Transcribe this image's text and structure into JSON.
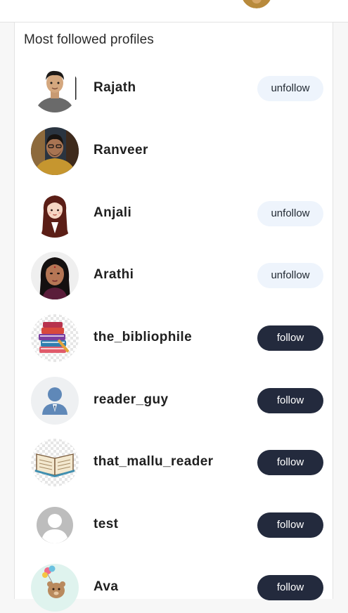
{
  "section": {
    "title": "Most followed profiles"
  },
  "profiles": [
    {
      "name": "Rajath",
      "action": "unfollow",
      "avatar": "photo-boy-avatar"
    },
    {
      "name": "Ranveer",
      "action": "",
      "avatar": "photo-man-avatar"
    },
    {
      "name": "Anjali",
      "action": "unfollow",
      "avatar": "cartoon-girl-avatar"
    },
    {
      "name": "Arathi",
      "action": "unfollow",
      "avatar": "photo-woman-avatar"
    },
    {
      "name": "the_bibliophile",
      "action": "follow",
      "avatar": "books-stack-avatar"
    },
    {
      "name": "reader_guy",
      "action": "follow",
      "avatar": "default-person-avatar"
    },
    {
      "name": "that_mallu_reader",
      "action": "follow",
      "avatar": "open-book-avatar"
    },
    {
      "name": "test",
      "action": "follow",
      "avatar": "grey-person-avatar"
    },
    {
      "name": "Ava",
      "action": "follow",
      "avatar": "teddy-balloon-avatar"
    }
  ],
  "colors": {
    "follow_bg": "#232a3d",
    "unfollow_bg": "#eef4fc",
    "panel_bg": "#ffffff",
    "page_bg": "#f7f7f7"
  }
}
